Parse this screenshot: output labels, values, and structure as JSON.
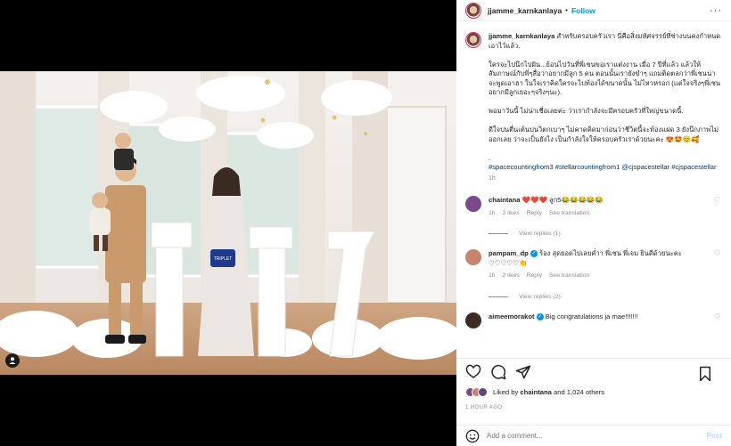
{
  "post": {
    "author": "jjamme_karnkanlaya",
    "follow_label": "Follow",
    "more_label": "···",
    "letter_card": "TRIPLET"
  },
  "caption": {
    "author": "jjamme_karnkanlaya",
    "lines": [
      "สำหรับครอบครัวเรา นี่คือสิ่งมหัศจรรย์ที่ช่างบนคงกำหนดเอาไว้แล้ว.",
      "ใครจะไปนึกไปฝัน...ย้อนไปวันที่พี่เชนขอเราแต่งงาน เมื่อ 7 ปีที่แล้ว แล้วให้สัมภาษณ์กับพี่ๆสื่อว่าอยากมีลูก 5 คน ตอนนั้นเรายังขำๆ แถมติดตลกว่าพี่เชนน่าจะพูดเอาฮา ในใจเราคิดใครจะไปท้องได้ขนาดนั้น ไม่ไหวหรอก (แต่ใจจริงๆพี่เชนอยากมีลูกเยอะๆจริงๆนะ).",
      "พอมาวันนี้ ไม่น่าเชื่อเลยค่ะ ว่าเรากำลังจะมีครอบครัวที่ใหญ่ขนาดนี้.",
      "ดีใจปนตื่นเต้นปนวิตกเบาๆ ไม่คาดคิดมาก่อนว่าชีวิตนี้จะท้องแฝด 3 ยังนึกภาพไม่ออกเลย ว่าจะเป็นยังไง เป็นกำลังใจให้ครอบครัวเราด้วยนะคะ 😍🤩😊🥰",
      "."
    ],
    "hashtags": "#spacecountingfrom3 #stellarcountingfrom1 @cjspacestellar #cjspacestellar",
    "time": "1h"
  },
  "comments": [
    {
      "user": "chaintana",
      "text": "❤️❤️❤️ ลูก5😂😂😂😂😂",
      "time": "1h",
      "likes": "2 likes",
      "reply": "Reply",
      "translate": "See translation",
      "replies": "View replies (1)",
      "verified": false,
      "avatar_color": "#7a4b8c"
    },
    {
      "user": "pampam_dp",
      "text": "ร้อง สุดยอดไปเลยค่ำา พี่เชน พี่เจม ยินดีด้วยนะคะ ♡♡♡♡♡👏",
      "time": "1h",
      "likes": "2 likes",
      "reply": "Reply",
      "translate": "See translation",
      "replies": "View replies (2)",
      "verified": true,
      "avatar_color": "#c5846b"
    },
    {
      "user": "aimeemorakot",
      "text": "Big congratulations ja mae!!!!!!!",
      "verified": true,
      "avatar_color": "#3b2a25"
    }
  ],
  "likes": {
    "prefix": "Liked by",
    "user": "chaintana",
    "suffix": "and 1,024 others"
  },
  "timestamp": "1 HOUR AGO",
  "add_comment": {
    "placeholder": "Add a comment...",
    "post_label": "Post"
  },
  "colors": {
    "link_blue": "#0095f6",
    "muted": "#8e8e8e",
    "post_disabled": "#b2dffc"
  }
}
